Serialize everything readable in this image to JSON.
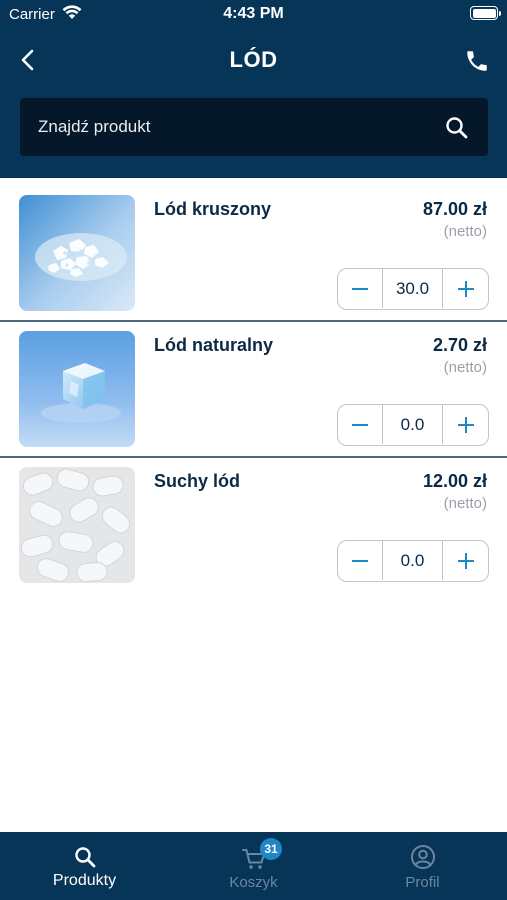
{
  "status_bar": {
    "carrier": "Carrier",
    "time": "4:43 PM"
  },
  "header": {
    "title": "LÓD",
    "back_icon": "chevron-left-icon",
    "call_icon": "phone-icon"
  },
  "search": {
    "placeholder": "Znajdź produkt",
    "icon": "search-icon"
  },
  "products": [
    {
      "name": "Lód kruszony",
      "price": "87.00 zł",
      "price_note": "(netto)",
      "quantity": "30.0"
    },
    {
      "name": "Lód naturalny",
      "price": "2.70 zł",
      "price_note": "(netto)",
      "quantity": "0.0"
    },
    {
      "name": "Suchy lód",
      "price": "12.00 zł",
      "price_note": "(netto)",
      "quantity": "0.0"
    }
  ],
  "tabs": [
    {
      "label": "Produkty",
      "icon": "search-icon",
      "active": true
    },
    {
      "label": "Koszyk",
      "icon": "cart-icon",
      "active": false,
      "badge": "31"
    },
    {
      "label": "Profil",
      "icon": "user-circle-icon",
      "active": false
    }
  ],
  "colors": {
    "header_bg": "#073558",
    "search_bg": "#04182a",
    "accent": "#1f86c7",
    "text_dark": "#0c2a45",
    "text_muted": "#9aa3ab"
  }
}
